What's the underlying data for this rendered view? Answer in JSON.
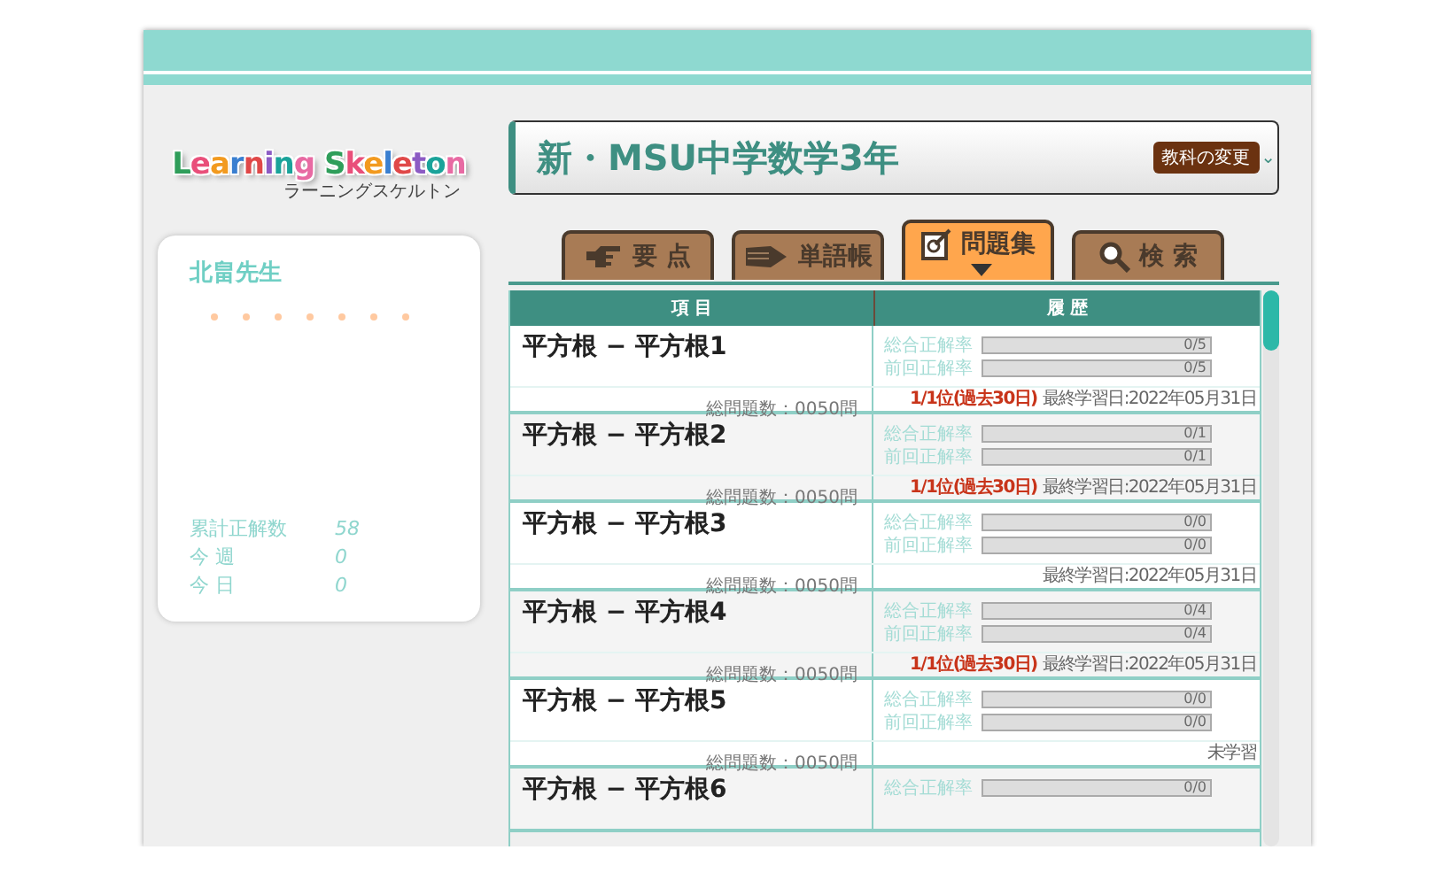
{
  "logo": {
    "title": "Learning Skeleton",
    "subtitle": "ラーニングスケルトン"
  },
  "user": {
    "name": "北畠先生",
    "stats": [
      {
        "label": "累計正解数",
        "value": "58"
      },
      {
        "label": "今 週",
        "value": "0"
      },
      {
        "label": "今 日",
        "value": "0"
      }
    ]
  },
  "subject": {
    "title": "新・MSU中学数学3年",
    "change_button": "教科の変更",
    "caret": "⌄"
  },
  "tabs": [
    {
      "label": "要 点",
      "selected": false
    },
    {
      "label": "単語帳",
      "selected": false
    },
    {
      "label": "問題集",
      "selected": true
    },
    {
      "label": "検 索",
      "selected": false
    }
  ],
  "table": {
    "columns": [
      "項 目",
      "履 歴"
    ],
    "rows": [
      {
        "title": "平方根 − 平方根1",
        "rates": [
          {
            "label": "総合正解率",
            "level": 0,
            "reading": "0/5"
          },
          {
            "label": "前回正解率",
            "level": 0,
            "reading": "0/5"
          }
        ],
        "count": "総問題数：0050問",
        "rank": "1/1位(過去30日)",
        "last_study": "最終学習日:2022年05月31日"
      },
      {
        "title": "平方根 − 平方根2",
        "rates": [
          {
            "label": "総合正解率",
            "level": 0,
            "reading": "0/1"
          },
          {
            "label": "前回正解率",
            "level": 0,
            "reading": "0/1"
          }
        ],
        "count": "総問題数：0050問",
        "rank": "1/1位(過去30日)",
        "last_study": "最終学習日:2022年05月31日"
      },
      {
        "title": "平方根 − 平方根3",
        "rates": [
          {
            "label": "総合正解率",
            "level": 0,
            "reading": "0/0"
          },
          {
            "label": "前回正解率",
            "level": 0,
            "reading": "0/0"
          }
        ],
        "count": "総問題数：0050問",
        "last_study": "最終学習日:2022年05月31日"
      },
      {
        "title": "平方根 − 平方根4",
        "rates": [
          {
            "label": "総合正解率",
            "level": 0,
            "reading": "0/4"
          },
          {
            "label": "前回正解率",
            "level": 0,
            "reading": "0/4"
          }
        ],
        "count": "総問題数：0050問",
        "rank": "1/1位(過去30日)",
        "last_study": "最終学習日:2022年05月31日"
      },
      {
        "title": "平方根 − 平方根5",
        "rates": [
          {
            "label": "総合正解率",
            "level": 0,
            "reading": "0/0"
          },
          {
            "label": "前回正解率",
            "level": 0,
            "reading": "0/0"
          }
        ],
        "count": "総問題数：0050問",
        "last_study": "未学習"
      },
      {
        "title": "平方根 − 平方根6",
        "rates": [
          {
            "label": "総合正解率",
            "level": 0,
            "reading": "0/0"
          }
        ]
      }
    ]
  }
}
